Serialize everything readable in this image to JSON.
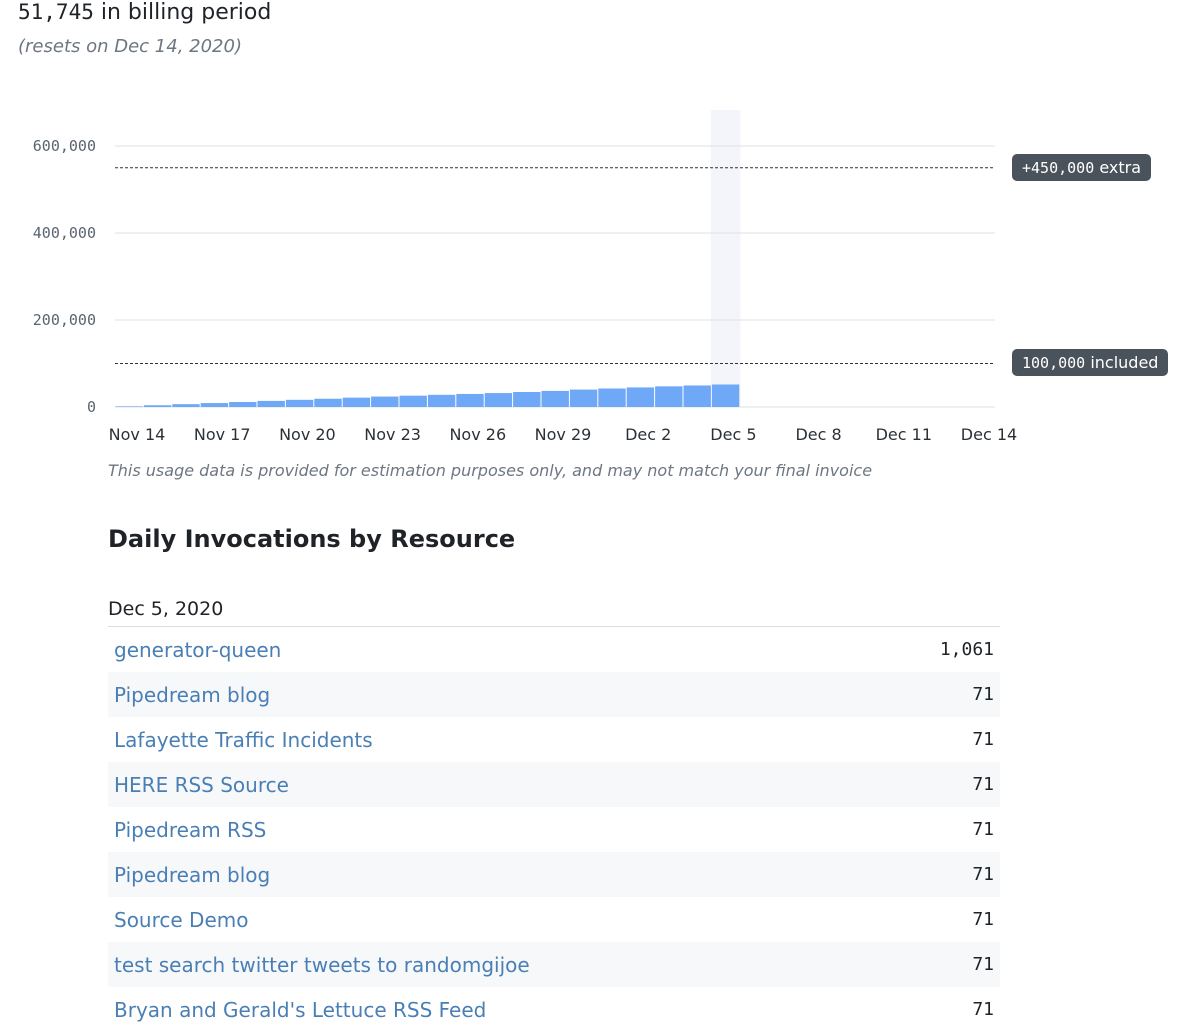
{
  "summary": {
    "count": "51,745",
    "suffix": "in billing period",
    "reset_note": "(resets on Dec 14, 2020)"
  },
  "markers": {
    "extra": {
      "value": 550000,
      "number": "+450,000",
      "text": "extra"
    },
    "included": {
      "value": 100000,
      "number": "100,000",
      "text": "included"
    }
  },
  "chart_data": {
    "type": "bar",
    "y_ticks": [
      0,
      200000,
      400000,
      600000
    ],
    "y_tick_labels": [
      "0",
      "200,000",
      "400,000",
      "600,000"
    ],
    "ylim": [
      0,
      600000
    ],
    "x_tick_labels": [
      "Nov 14",
      "Nov 17",
      "Nov 20",
      "Nov 23",
      "Nov 26",
      "Nov 29",
      "Dec 2",
      "Dec 5",
      "Dec 8",
      "Dec 11",
      "Dec 14"
    ],
    "categories": [
      "Nov 14",
      "Nov 15",
      "Nov 16",
      "Nov 17",
      "Nov 18",
      "Nov 19",
      "Nov 20",
      "Nov 21",
      "Nov 22",
      "Nov 23",
      "Nov 24",
      "Nov 25",
      "Nov 26",
      "Nov 27",
      "Nov 28",
      "Nov 29",
      "Nov 30",
      "Dec 1",
      "Dec 2",
      "Dec 3",
      "Dec 4",
      "Dec 5"
    ],
    "values": [
      1500,
      4000,
      6500,
      9000,
      11500,
      14000,
      16500,
      19000,
      21500,
      24000,
      26000,
      28000,
      30000,
      32000,
      34500,
      37000,
      40000,
      42500,
      45000,
      47500,
      49500,
      51745
    ],
    "highlighted_category": "Dec 5",
    "bar_color": "#6ea8f7",
    "grid": true
  },
  "disclaimer": "This usage data is provided for estimation purposes only, and may not match your final invoice",
  "section_title": "Daily Invocations by Resource",
  "table": {
    "date": "Dec 5, 2020",
    "rows": [
      {
        "name": "generator-queen",
        "count": "1,061"
      },
      {
        "name": "Pipedream blog",
        "count": "71"
      },
      {
        "name": "Lafayette Traffic Incidents",
        "count": "71"
      },
      {
        "name": "HERE RSS Source",
        "count": "71"
      },
      {
        "name": "Pipedream RSS",
        "count": "71"
      },
      {
        "name": "Pipedream blog",
        "count": "71"
      },
      {
        "name": "Source Demo",
        "count": "71"
      },
      {
        "name": "test search twitter tweets to randomgijoe",
        "count": "71"
      },
      {
        "name": "Bryan and Gerald's Lettuce RSS Feed",
        "count": "71"
      }
    ]
  },
  "colors": {
    "link": "#4a7fb5",
    "bar": "#6ea8f7",
    "pill_bg": "#4a535c",
    "highlight_band": "#f3f5fa"
  }
}
